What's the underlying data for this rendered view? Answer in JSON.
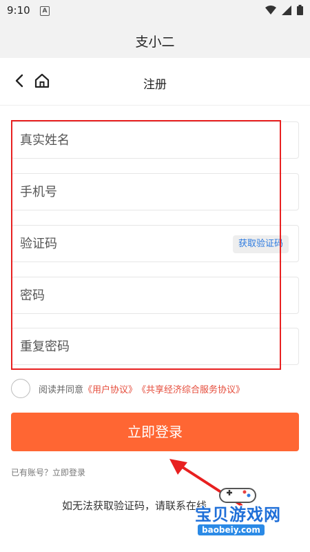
{
  "status": {
    "time": "9:10",
    "notification_badge": "A"
  },
  "app": {
    "title": "支小二"
  },
  "nav": {
    "title": "注册"
  },
  "form": {
    "name_placeholder": "真实姓名",
    "phone_placeholder": "手机号",
    "code_placeholder": "验证码",
    "get_code_label": "获取验证码",
    "password_placeholder": "密码",
    "repeat_password_placeholder": "重复密码"
  },
  "agreement": {
    "prefix": "阅读并同意",
    "user_agreement": "《用户协议》",
    "service_agreement": "《共享经济综合服务协议》"
  },
  "submit_label": "立即登录",
  "login": {
    "prompt": "已有账号？",
    "link": "立即登录"
  },
  "contact_text": "如无法获取验证码，请联系在线",
  "watermark": {
    "title": "宝贝游戏网",
    "url": "baobeiy.com"
  },
  "colors": {
    "accent": "#ff6633",
    "link_blue": "#2d7be0",
    "highlight_red": "#e82020"
  }
}
